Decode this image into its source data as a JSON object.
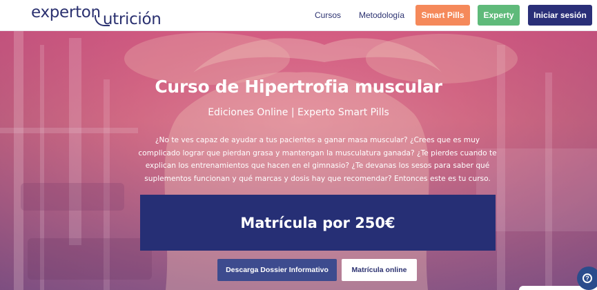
{
  "header": {
    "logo": {
      "part1": "experton",
      "part2": "utrición"
    },
    "nav": {
      "cursos": "Cursos",
      "metodologia": "Metodología"
    },
    "buttons": {
      "smart_pills": "Smart Pills",
      "experty": "Experty",
      "login": "Iniciar sesión"
    }
  },
  "hero": {
    "title": "Curso de Hipertrofia muscular",
    "subtitle": "Ediciones Online | Experto Smart Pills",
    "description": "¿No te ves capaz de ayudar a tus pacientes a ganar masa muscular? ¿Crees que es muy complicado lograr que pierdan grasa y mantengan la musculatura ganada? ¿Te pierdes cuando te explican los entrenamientos que hacen en el gimnasio? ¿Te devanas los sesos para saber qué suplementos funcionan y qué marcas y dosis hay que recomendar? Entonces este es tu curso.",
    "price": "Matrícula por 250€",
    "cta_dossier": "Descarga Dossier Informativo",
    "cta_matricula": "Matrícula online"
  },
  "help": {
    "icon": "help-circle-icon",
    "symbol": "?"
  },
  "colors": {
    "brand_navy": "#262f75",
    "smart_pills": "#f5895a",
    "experty": "#5fba7a",
    "hero_overlay": "#d64e80"
  }
}
